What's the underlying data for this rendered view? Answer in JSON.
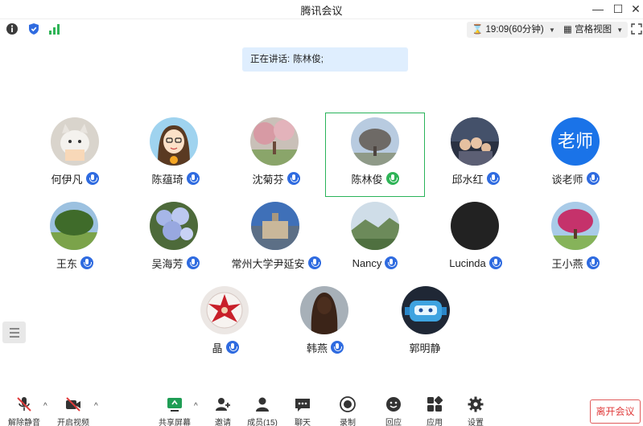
{
  "window": {
    "title": "腾讯会议",
    "controls": {
      "minimize": "—",
      "maximize": "☐",
      "close": "✕"
    }
  },
  "toolbar": {
    "info_icon": "info-icon",
    "shield_icon": "shield-icon",
    "signal_icon": "signal-icon",
    "timer_label": "19:09(60分钟)",
    "view_label": "宫格视图"
  },
  "speaking": {
    "prefix": "正在讲话:",
    "name": "陈林俊;"
  },
  "participants": [
    {
      "name": "何伊凡",
      "avatar": "cat-photo",
      "mic": "on"
    },
    {
      "name": "陈蕴琦",
      "avatar": "cartoon-girl",
      "mic": "on"
    },
    {
      "name": "沈菊芬",
      "avatar": "cherry-blossom-photo",
      "mic": "on"
    },
    {
      "name": "陈林俊",
      "avatar": "tree-photo",
      "mic": "speaking"
    },
    {
      "name": "邱水红",
      "avatar": "family-photo",
      "mic": "on"
    },
    {
      "name": "谈老师",
      "avatar": "老师",
      "mic": "on"
    },
    {
      "name": "王东",
      "avatar": "park-photo",
      "mic": "on"
    },
    {
      "name": "吴海芳",
      "avatar": "flowers-photo",
      "mic": "on"
    },
    {
      "name": "常州大学尹延安",
      "avatar": "building-photo",
      "mic": "on"
    },
    {
      "name": "Nancy",
      "avatar": "mountain-photo",
      "mic": "on"
    },
    {
      "name": "Lucinda",
      "avatar": "black-circle",
      "mic": "on"
    },
    {
      "name": "王小燕",
      "avatar": "pink-tree-photo",
      "mic": "on"
    },
    {
      "name": "晶",
      "avatar": "red-flower-photo",
      "mic": "on"
    },
    {
      "name": "韩燕",
      "avatar": "long-hair-photo",
      "mic": "on"
    },
    {
      "name": "郭明静",
      "avatar": "robot-cartoon",
      "mic": "off"
    }
  ],
  "bottombar": {
    "unmute": "解除静音",
    "video": "开启视频",
    "share": "共享屏幕",
    "invite": "邀请",
    "members": "成员(15)",
    "chat": "聊天",
    "record": "录制",
    "reaction": "回应",
    "apps": "应用",
    "settings": "设置",
    "leave": "离开会议"
  },
  "colors": {
    "accent": "#2f6be0",
    "speaking_green": "#29b35a",
    "banner_bg": "#dfeefe",
    "leave_red": "#e03c3c"
  }
}
